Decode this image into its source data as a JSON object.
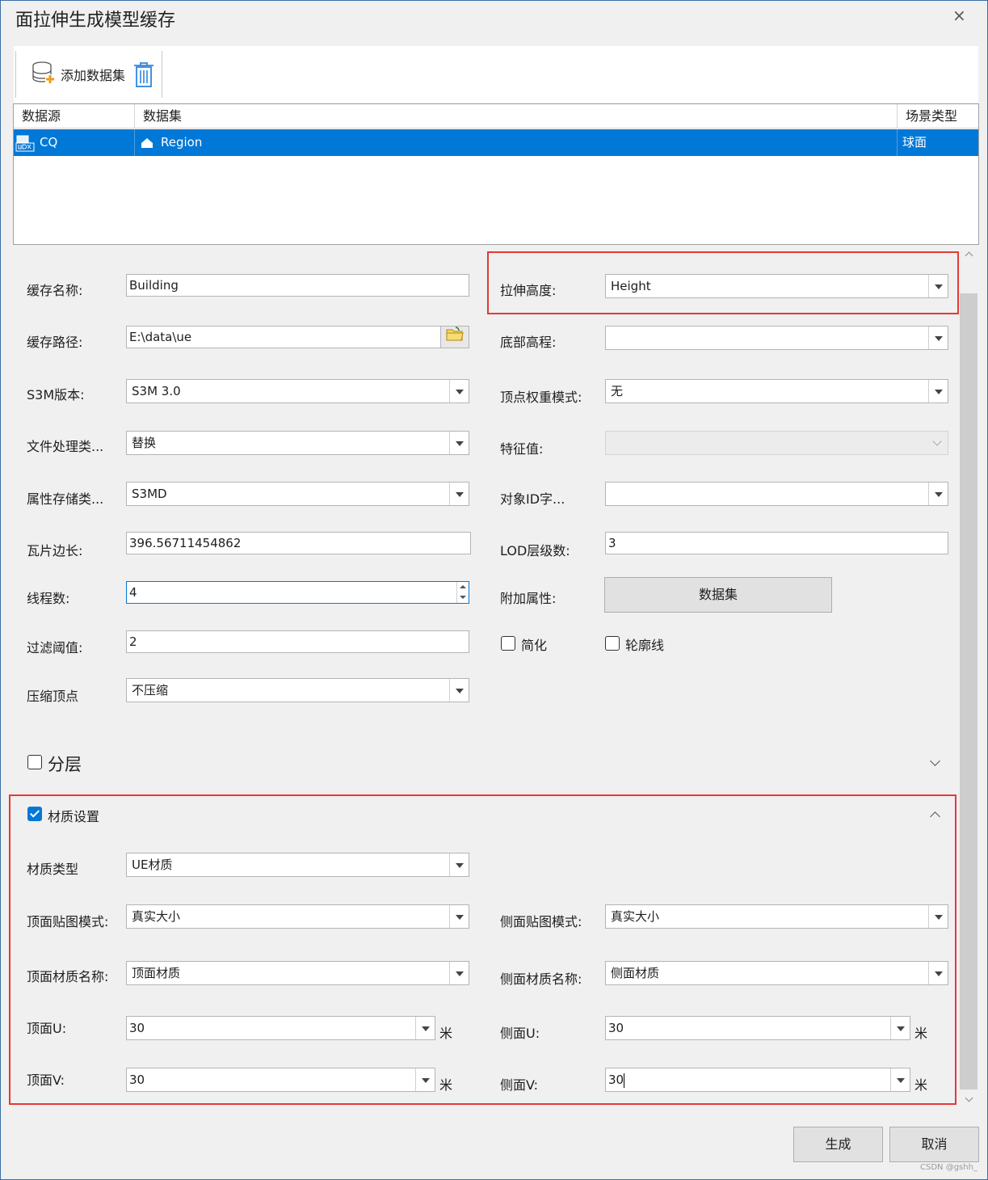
{
  "window": {
    "title": "面拉伸生成模型缓存",
    "close_glyph": "×"
  },
  "toolbar": {
    "add_dataset_label": "添加数据集"
  },
  "grid": {
    "columns": [
      "数据源",
      "数据集",
      "场景类型"
    ],
    "rows": [
      {
        "datasource": "CQ",
        "dataset": "Region",
        "scene_type": "球面"
      }
    ]
  },
  "form": {
    "cache_name": {
      "label": "缓存名称:",
      "value": "Building"
    },
    "cache_path": {
      "label": "缓存路径:",
      "value": "E:\\data\\ue"
    },
    "s3m_version": {
      "label": "S3M版本:",
      "value": "S3M 3.0"
    },
    "file_handling": {
      "label": "文件处理类...",
      "value": "替换"
    },
    "attr_storage": {
      "label": "属性存储类...",
      "value": "S3MD"
    },
    "tile_size": {
      "label": "瓦片边长:",
      "value": "396.56711454862"
    },
    "threads": {
      "label": "线程数:",
      "value": "4"
    },
    "filter_threshold": {
      "label": "过滤阈值:",
      "value": "2"
    },
    "compress_vertex": {
      "label": "压缩顶点",
      "value": "不压缩"
    },
    "extrude_height": {
      "label": "拉伸高度:",
      "value": "Height"
    },
    "base_elevation": {
      "label": "底部高程:",
      "value": ""
    },
    "vertex_weight": {
      "label": "顶点权重模式:",
      "value": "无"
    },
    "feature_value": {
      "label": "特征值:",
      "value": ""
    },
    "object_id": {
      "label": "对象ID字...",
      "value": ""
    },
    "lod_levels": {
      "label": "LOD层级数:",
      "value": "3"
    },
    "extra_attr": {
      "label": "附加属性:",
      "button": "数据集"
    },
    "simplify": {
      "label": "简化",
      "checked": false
    },
    "outline": {
      "label": "轮廓线",
      "checked": false
    }
  },
  "layering": {
    "label": "分层",
    "checked": false
  },
  "material": {
    "label": "材质设置",
    "checked": true,
    "type": {
      "label": "材质类型",
      "value": "UE材质"
    },
    "top_map_mode": {
      "label": "顶面贴图模式:",
      "value": "真实大小"
    },
    "side_map_mode": {
      "label": "侧面贴图模式:",
      "value": "真实大小"
    },
    "top_material_name": {
      "label": "顶面材质名称:",
      "value": "顶面材质"
    },
    "side_material_name": {
      "label": "侧面材质名称:",
      "value": "侧面材质"
    },
    "top_u": {
      "label": "顶面U:",
      "value": "30",
      "unit": "米"
    },
    "side_u": {
      "label": "侧面U:",
      "value": "30",
      "unit": "米"
    },
    "top_v": {
      "label": "顶面V:",
      "value": "30",
      "unit": "米"
    },
    "side_v": {
      "label": "侧面V:",
      "value": "30",
      "unit": "米"
    }
  },
  "footer": {
    "generate_label": "生成",
    "cancel_label": "取消"
  },
  "watermark": "CSDN @gshh_",
  "colors": {
    "selection": "#0078d7",
    "highlight": "#e53935",
    "accent_icon": "#f39c12"
  }
}
